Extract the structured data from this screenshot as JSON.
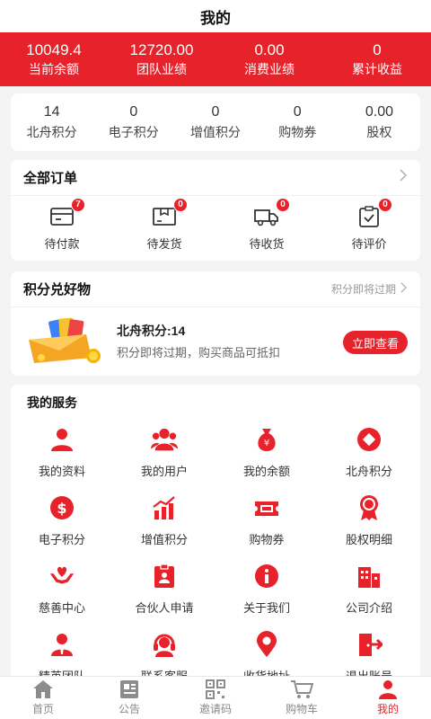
{
  "header": {
    "title": "我的"
  },
  "stats": [
    {
      "value": "10049.4",
      "label": "当前余额"
    },
    {
      "value": "12720.00",
      "label": "团队业绩"
    },
    {
      "value": "0.00",
      "label": "消费业绩"
    },
    {
      "value": "0",
      "label": "累计收益"
    }
  ],
  "points": [
    {
      "value": "14",
      "label": "北舟积分"
    },
    {
      "value": "0",
      "label": "电子积分"
    },
    {
      "value": "0",
      "label": "增值积分"
    },
    {
      "value": "0",
      "label": "购物券"
    },
    {
      "value": "0.00",
      "label": "股权"
    }
  ],
  "orders": {
    "title": "全部订单",
    "items": [
      {
        "label": "待付款",
        "badge": "7",
        "icon": "wallet-icon"
      },
      {
        "label": "待发货",
        "badge": "0",
        "icon": "package-icon"
      },
      {
        "label": "待收货",
        "badge": "0",
        "icon": "truck-icon"
      },
      {
        "label": "待评价",
        "badge": "0",
        "icon": "clipboard-check-icon"
      }
    ]
  },
  "exchange": {
    "title": "积分兑好物",
    "hint": "积分即将过期",
    "item_title": "北舟积分:14",
    "item_desc": "积分即将过期，购买商品可抵扣",
    "button": "立即查看"
  },
  "services": {
    "title": "我的服务",
    "items": [
      {
        "label": "我的资料",
        "icon": "person-icon"
      },
      {
        "label": "我的用户",
        "icon": "users-icon"
      },
      {
        "label": "我的余额",
        "icon": "money-bag-icon"
      },
      {
        "label": "北舟积分",
        "icon": "diamond-icon"
      },
      {
        "label": "电子积分",
        "icon": "dollar-icon"
      },
      {
        "label": "增值积分",
        "icon": "growth-chart-icon"
      },
      {
        "label": "购物券",
        "icon": "ticket-icon"
      },
      {
        "label": "股权明细",
        "icon": "medal-icon"
      },
      {
        "label": "慈善中心",
        "icon": "heart-hands-icon"
      },
      {
        "label": "合伙人申请",
        "icon": "partner-icon"
      },
      {
        "label": "关于我们",
        "icon": "info-icon"
      },
      {
        "label": "公司介绍",
        "icon": "building-icon"
      },
      {
        "label": "精英团队",
        "icon": "elite-icon"
      },
      {
        "label": "联系客服",
        "icon": "headset-icon"
      },
      {
        "label": "收货地址",
        "icon": "location-pin-icon"
      },
      {
        "label": "退出账号",
        "icon": "logout-icon"
      }
    ]
  },
  "tabbar": [
    {
      "label": "首页",
      "icon": "home-icon",
      "active": false
    },
    {
      "label": "公告",
      "icon": "notice-icon",
      "active": false
    },
    {
      "label": "邀请码",
      "icon": "qrcode-icon",
      "active": false
    },
    {
      "label": "购物车",
      "icon": "cart-icon",
      "active": false
    },
    {
      "label": "我的",
      "icon": "profile-icon",
      "active": true
    }
  ],
  "colors": {
    "accent": "#e8222a",
    "background": "#f4f4f4",
    "tab_inactive": "#888888"
  }
}
